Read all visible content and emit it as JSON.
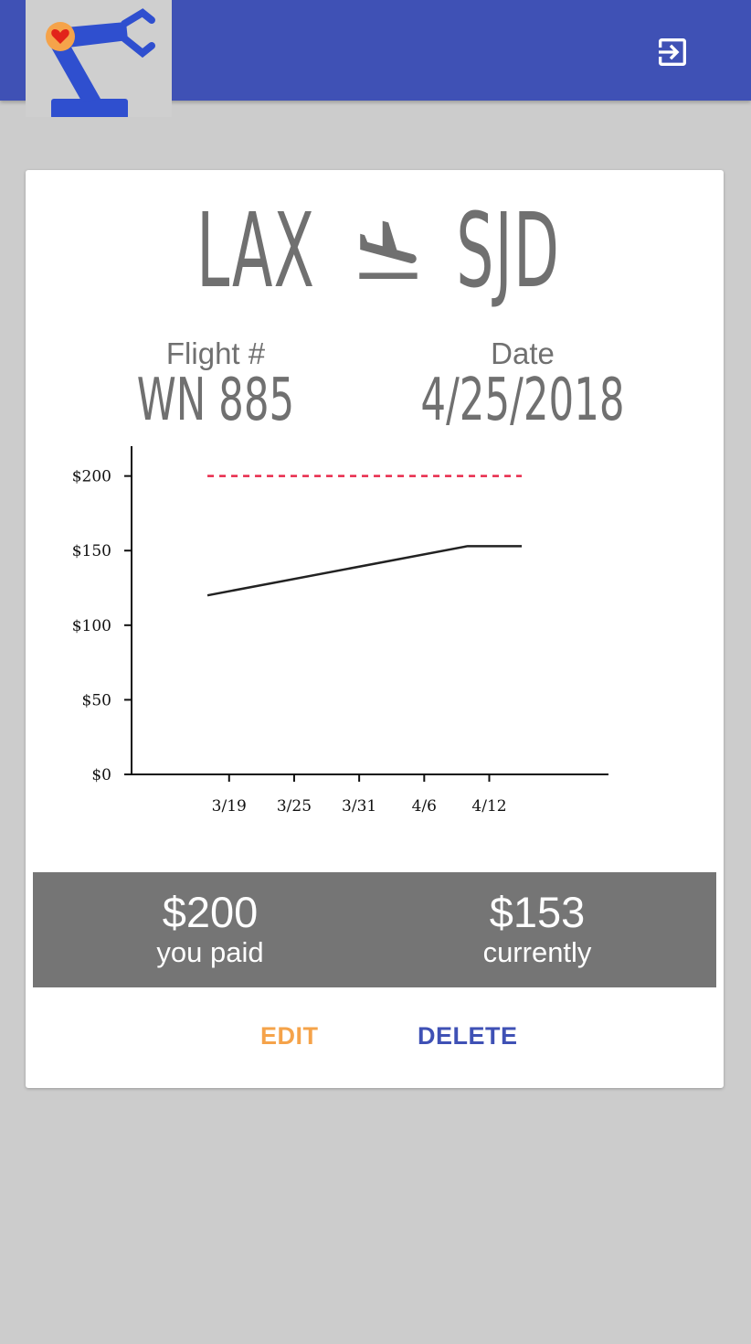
{
  "header": {
    "logo_icon": "robot-arm-heart-logo",
    "logout_icon": "exit-to-app-icon",
    "bar_color": "#3f51b5"
  },
  "flight": {
    "origin": "LAX",
    "destination": "SJD",
    "route_icon": "flight-land-icon",
    "flight_label": "Flight #",
    "flight_number": "WN 885",
    "date_label": "Date",
    "date": "4/25/2018"
  },
  "chart_data": {
    "type": "line",
    "title": "",
    "xlabel": "",
    "ylabel": "",
    "y_ticks": [
      "$0",
      "$50",
      "$100",
      "$150",
      "$200"
    ],
    "y_tick_values": [
      0,
      50,
      100,
      150,
      200
    ],
    "x_ticks": [
      "3/19",
      "3/25",
      "3/31",
      "4/6",
      "4/12"
    ],
    "ylim": [
      0,
      220
    ],
    "xlim": [
      "3/10",
      "4/23"
    ],
    "series": [
      {
        "color": "#222222",
        "style": "solid",
        "points": [
          {
            "x": "3/17",
            "y": 120
          },
          {
            "x": "4/10",
            "y": 153
          },
          {
            "x": "4/15",
            "y": 153
          }
        ]
      },
      {
        "color": "#e8294a",
        "style": "dashed",
        "points": [
          {
            "x": "3/17",
            "y": 200
          },
          {
            "x": "4/15",
            "y": 200
          }
        ]
      }
    ]
  },
  "summary": {
    "paid_amount": "$200",
    "paid_label": "you paid",
    "current_amount": "$153",
    "current_label": "currently"
  },
  "actions": {
    "edit_label": "EDIT",
    "edit_color": "#f5a34a",
    "delete_label": "DELETE",
    "delete_color": "#3f51b5"
  }
}
